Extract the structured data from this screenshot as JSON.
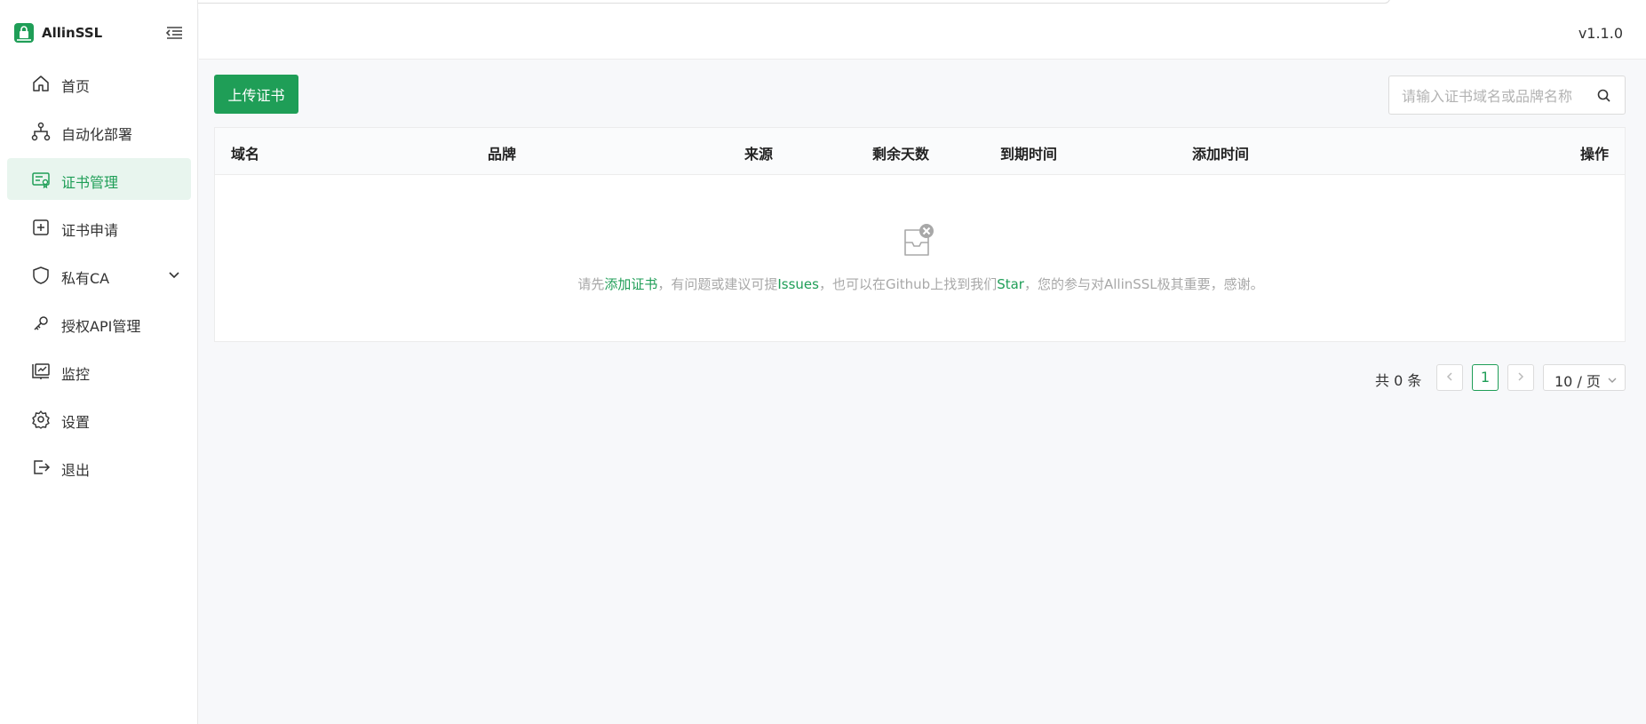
{
  "brand": {
    "name": "AllinSSL"
  },
  "header": {
    "version": "v1.1.0"
  },
  "sidebar": {
    "items": [
      {
        "label": "首页",
        "icon": "home-icon"
      },
      {
        "label": "自动化部署",
        "icon": "workflow-icon"
      },
      {
        "label": "证书管理",
        "icon": "certificate-icon",
        "active": true
      },
      {
        "label": "证书申请",
        "icon": "plus-square-icon"
      },
      {
        "label": "私有CA",
        "icon": "shield-icon",
        "expandable": true
      },
      {
        "label": "授权API管理",
        "icon": "api-key-icon"
      },
      {
        "label": "监控",
        "icon": "monitor-icon"
      },
      {
        "label": "设置",
        "icon": "gear-icon"
      },
      {
        "label": "退出",
        "icon": "logout-icon"
      }
    ]
  },
  "toolbar": {
    "upload_label": "上传证书",
    "search_placeholder": "请输入证书域名或品牌名称"
  },
  "table": {
    "columns": [
      "域名",
      "品牌",
      "来源",
      "剩余天数",
      "到期时间",
      "添加时间",
      "操作"
    ],
    "rows": []
  },
  "empty": {
    "t1": "请先",
    "link1": "添加证书",
    "t2": "，有问题或建议可提",
    "link2": "Issues",
    "t3": "，也可以在Github上找到我们",
    "link3": "Star",
    "t4": "，您的参与对AllinSSL极其重要，感谢。"
  },
  "pagination": {
    "total_label": "共 0 条",
    "current_page": "1",
    "page_size": "10 / 页"
  },
  "colors": {
    "accent": "#1f9e57",
    "active_bg": "#e8f5ee"
  }
}
